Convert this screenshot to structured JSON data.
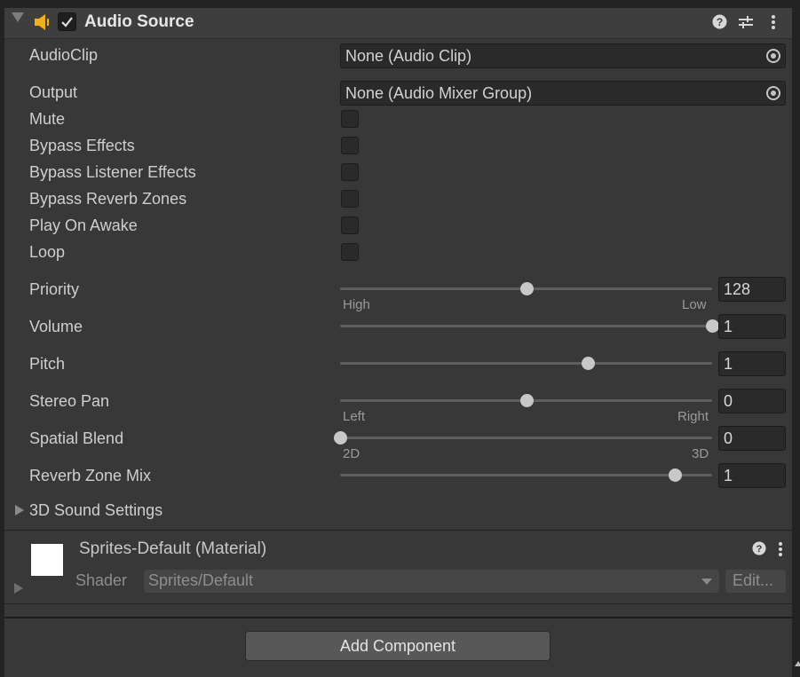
{
  "component": {
    "title": "Audio Source",
    "enabled": true,
    "icons": [
      "speaker-icon",
      "help-icon",
      "presets-icon",
      "more-menu-icon"
    ]
  },
  "fields": {
    "audio_clip": {
      "label": "AudioClip",
      "value": "None (Audio Clip)"
    },
    "output": {
      "label": "Output",
      "value": "None (Audio Mixer Group)"
    },
    "mute": {
      "label": "Mute",
      "checked": false
    },
    "bypass_effects": {
      "label": "Bypass Effects",
      "checked": false
    },
    "bypass_listener_effects": {
      "label": "Bypass Listener Effects",
      "checked": false
    },
    "bypass_reverb_zones": {
      "label": "Bypass Reverb Zones",
      "checked": false
    },
    "play_on_awake": {
      "label": "Play On Awake",
      "checked": false
    },
    "loop": {
      "label": "Loop",
      "checked": false
    }
  },
  "sliders": {
    "priority": {
      "label": "Priority",
      "value": "128",
      "fraction": 0.5,
      "min_label": "High",
      "max_label": "Low"
    },
    "volume": {
      "label": "Volume",
      "value": "1",
      "fraction": 1.0
    },
    "pitch": {
      "label": "Pitch",
      "value": "1",
      "fraction": 0.667
    },
    "stereo_pan": {
      "label": "Stereo Pan",
      "value": "0",
      "fraction": 0.5,
      "min_label": "Left",
      "max_label": "Right"
    },
    "spatial_blend": {
      "label": "Spatial Blend",
      "value": "0",
      "fraction": 0.0,
      "min_label": "2D",
      "max_label": "3D"
    },
    "reverb_zone_mix": {
      "label": "Reverb Zone Mix",
      "value": "1",
      "fraction": 0.9
    }
  },
  "sound_settings": {
    "label": "3D Sound Settings"
  },
  "material": {
    "title": "Sprites-Default (Material)",
    "shader_label": "Shader",
    "shader_value": "Sprites/Default",
    "edit_label": "Edit..."
  },
  "add_component": {
    "label": "Add Component"
  },
  "colors": {
    "accent_speaker": "#f0b01e",
    "background": "#383838"
  }
}
